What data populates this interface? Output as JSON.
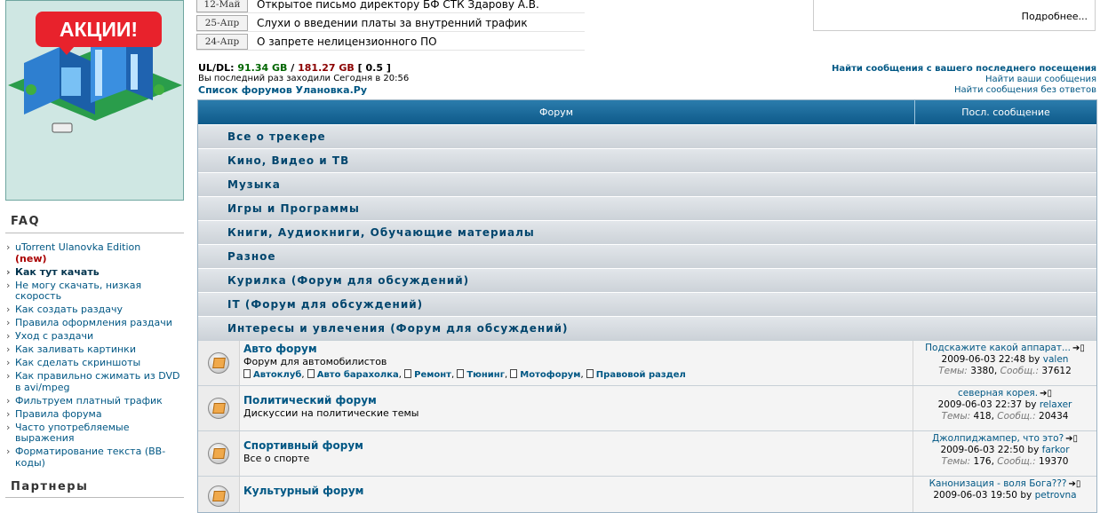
{
  "sidebar": {
    "promo_label": "АКЦИИ!",
    "faq_title": "FAQ",
    "faq_items": [
      {
        "label": "uTorrent Ulanovka Edition",
        "tag": "(new)"
      },
      {
        "label": "Как тут качать"
      },
      {
        "label": "Не могу скачать, низкая скорость"
      },
      {
        "label": "Как создать раздачу"
      },
      {
        "label": "Правила оформления раздачи"
      },
      {
        "label": "Уход с раздачи"
      },
      {
        "label": "Как заливать картинки"
      },
      {
        "label": "Как сделать скриншоты"
      },
      {
        "label": "Как правильно сжимать из DVD в avi/mpeg"
      },
      {
        "label": "Фильтруем платный трафик"
      },
      {
        "label": "Правила форума"
      },
      {
        "label": "Часто употребляемые выражения"
      },
      {
        "label": "Форматирование текста (BB-коды)"
      }
    ],
    "partners_title": "Партнеры"
  },
  "news": {
    "items": [
      {
        "date": "12-Май",
        "text": "Открытое письмо директору БФ СТК Здарову А.В."
      },
      {
        "date": "25-Апр",
        "text": "Слухи о введении платы за внутренний трафик"
      },
      {
        "date": "24-Апр",
        "text": "О запрете нелицензионного ПО"
      }
    ],
    "more_label": "Подробнее..."
  },
  "stats": {
    "uldl_label": "UL/DL:",
    "up": "91.34 GB",
    "slash": "/",
    "down": "181.27 GB",
    "ratio": "[ 0.5 ]",
    "last_visit": "Вы последний раз заходили Сегодня в 20:56",
    "forum_list_title": "Список форумов Улановка.Ру"
  },
  "links": {
    "since_last": "Найти сообщения с вашего последнего посещения",
    "your_posts": "Найти ваши сообщения",
    "unanswered": "Найти сообщения без ответов"
  },
  "table": {
    "col_forum": "Форум",
    "col_last": "Посл. сообщение",
    "categories": [
      "Все о трекере",
      "Кино, Видео и ТВ",
      "Музыка",
      "Игры и Программы",
      "Книги, Аудиокниги, Обучающие материалы",
      "Разное",
      "Курилка (Форум для обсуждений)",
      "IT (Форум для обсуждений)",
      "Интересы и увлечения (Форум для обсуждений)"
    ],
    "forums": [
      {
        "name": "Авто форум",
        "desc": "Форум для автомобилистов",
        "subs": [
          "Автоклуб",
          "Авто барахолка",
          "Ремонт",
          "Тюнинг",
          "Мотофорум",
          "Правовой раздел"
        ],
        "last_title": "Подскажите какой аппарат...",
        "last_date": "2009-06-03 22:48",
        "by": "by",
        "last_user": "valen",
        "topics": "3380",
        "posts": "37612"
      },
      {
        "name": "Политический форум",
        "desc": "Дискуссии на политические темы",
        "subs": [],
        "last_title": "северная корея.",
        "last_date": "2009-06-03 22:37",
        "by": "by",
        "last_user": "relaxer",
        "topics": "418",
        "posts": "20434"
      },
      {
        "name": "Спортивный форум",
        "desc": "Все о спорте",
        "subs": [],
        "last_title": "Джолпиджампер, что это?",
        "last_date": "2009-06-03 22:50",
        "by": "by",
        "last_user": "farkor",
        "topics": "176",
        "posts": "19370"
      },
      {
        "name": "Культурный форум",
        "desc": "",
        "subs": [],
        "last_title": "Канонизация - воля Бога???",
        "last_date": "2009-06-03 19:50",
        "by": "by",
        "last_user": "petrovna",
        "topics": "",
        "posts": ""
      }
    ],
    "topics_label": "Темы:",
    "posts_label": "Сообщ.:",
    "goto_glyph": "➔▯"
  }
}
